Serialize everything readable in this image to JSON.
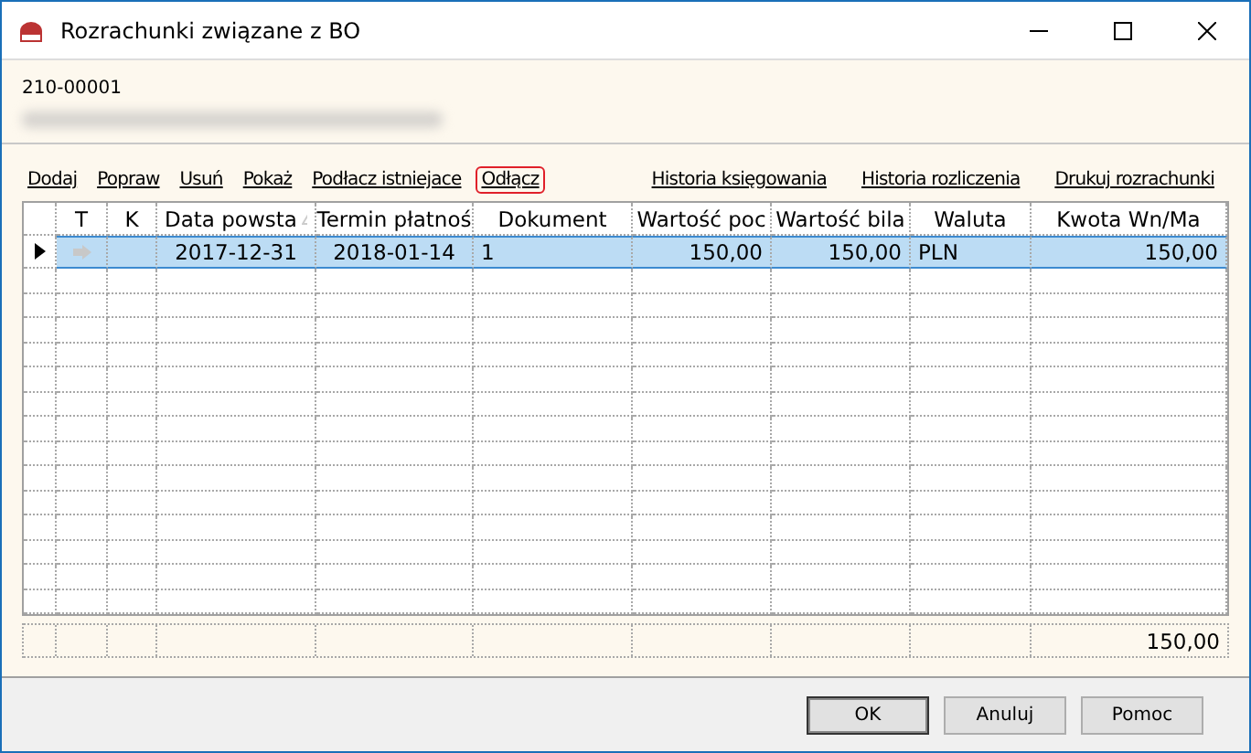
{
  "window": {
    "title": "Rozrachunki związane z BO"
  },
  "header": {
    "account": "210-00001"
  },
  "actions_left": [
    {
      "label": "Dodaj",
      "selected": false
    },
    {
      "label": "Popraw",
      "selected": false
    },
    {
      "label": "Usuń",
      "selected": false
    },
    {
      "label": "Pokaż",
      "selected": false
    },
    {
      "label": "Podłacz istniejace",
      "selected": false
    },
    {
      "label": "Odłącz",
      "selected": true
    }
  ],
  "actions_right": [
    {
      "label": "Historia księgowania"
    },
    {
      "label": "Historia rozliczenia"
    },
    {
      "label": "Drukuj rozrachunki"
    }
  ],
  "table": {
    "columns": [
      {
        "label": "T"
      },
      {
        "label": "K"
      },
      {
        "label": "Data powsta",
        "sorted": true
      },
      {
        "label": "Termin płatnoś"
      },
      {
        "label": "Dokument"
      },
      {
        "label": "Wartość poc"
      },
      {
        "label": "Wartość bila"
      },
      {
        "label": "Waluta"
      },
      {
        "label": "Kwota Wn/Ma"
      }
    ],
    "rows": [
      {
        "selected": true,
        "cells": [
          "",
          "",
          "2017-12-31",
          "2018-01-14",
          "1",
          "150,00",
          "150,00",
          "PLN",
          "150,00"
        ]
      }
    ],
    "total": "150,00"
  },
  "buttons": [
    {
      "label": "OK",
      "default": true
    },
    {
      "label": "Anuluj",
      "default": false
    },
    {
      "label": "Pomoc",
      "default": false
    }
  ]
}
